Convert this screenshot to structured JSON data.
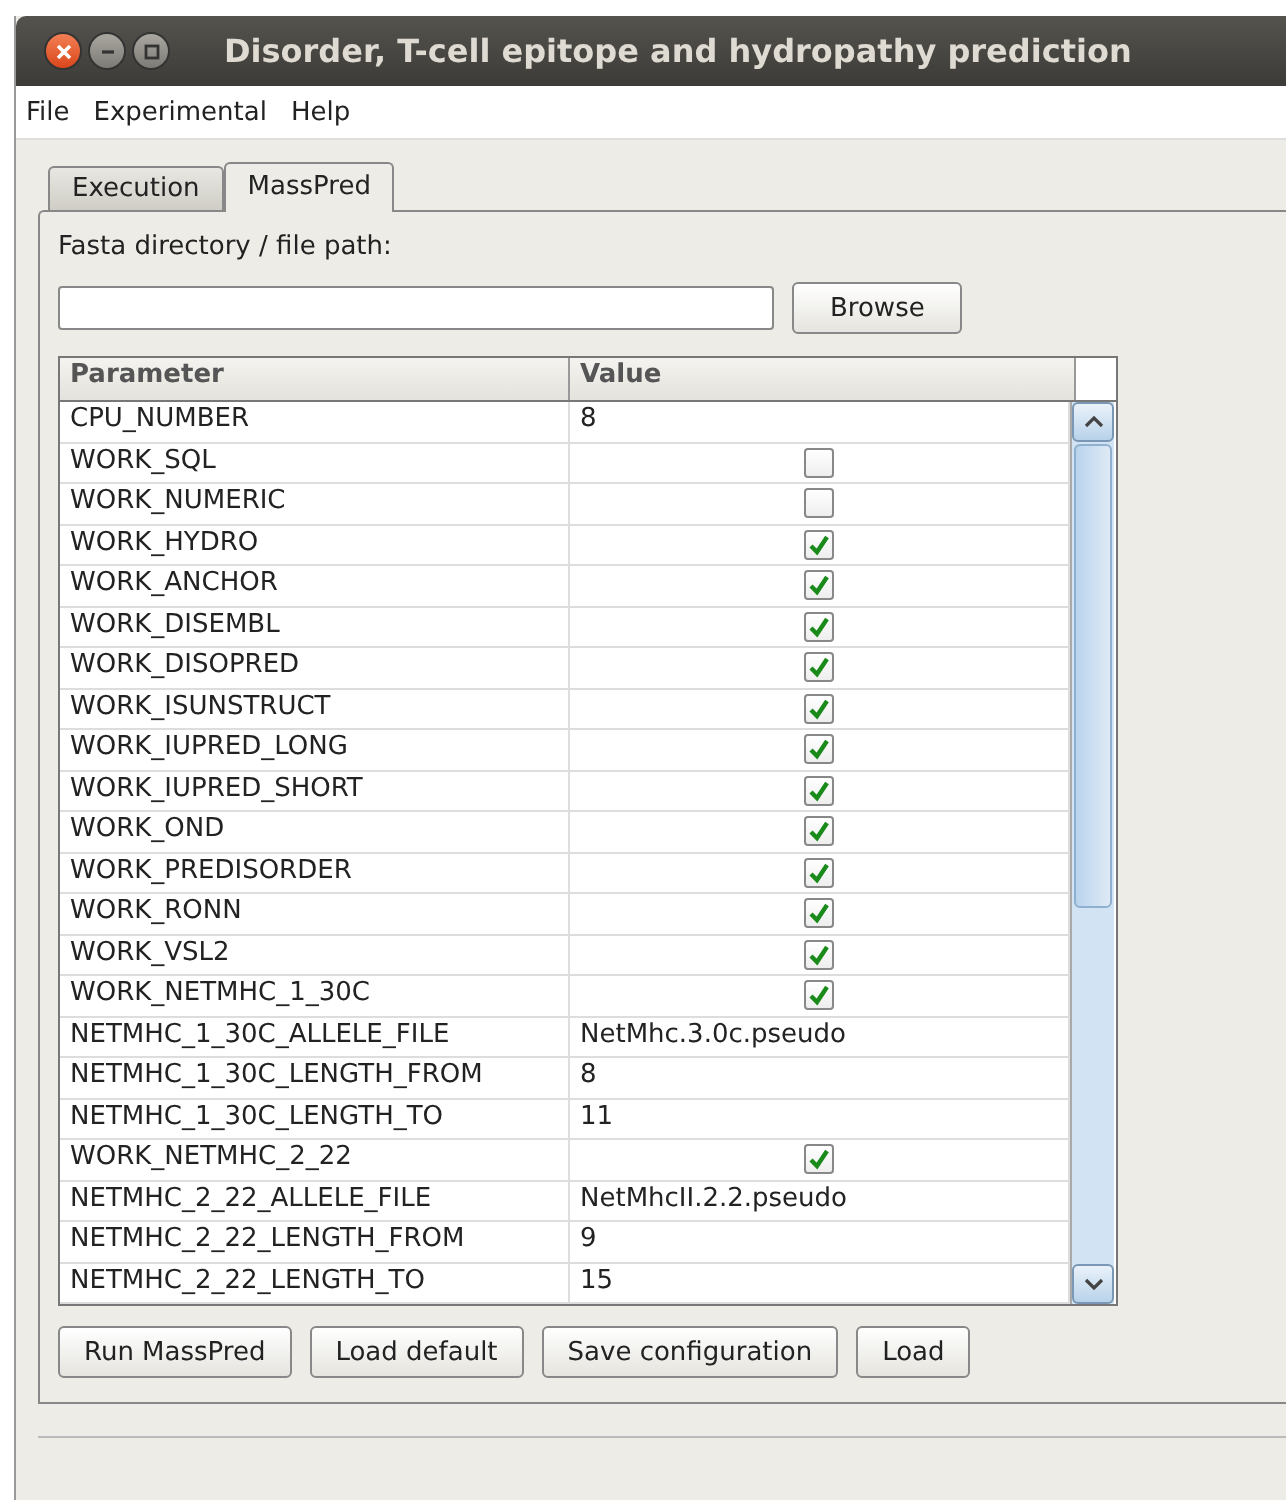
{
  "window": {
    "title": "Disorder, T-cell epitope and hydropathy prediction"
  },
  "menu": [
    "File",
    "Experimental",
    "Help"
  ],
  "tabs": [
    {
      "label": "Execution",
      "selected": false
    },
    {
      "label": "MassPred",
      "selected": true
    }
  ],
  "path_field": {
    "label": "Fasta directory / file path:",
    "browse": "Browse"
  },
  "table": {
    "columns": [
      "Parameter",
      "Value"
    ],
    "rows": [
      {
        "name": "CPU_NUMBER",
        "kind": "text",
        "value": "8"
      },
      {
        "name": "WORK_SQL",
        "kind": "checkbox",
        "checked": false
      },
      {
        "name": "WORK_NUMERIC",
        "kind": "checkbox",
        "checked": false
      },
      {
        "name": "WORK_HYDRO",
        "kind": "checkbox",
        "checked": true
      },
      {
        "name": "WORK_ANCHOR",
        "kind": "checkbox",
        "checked": true
      },
      {
        "name": "WORK_DISEMBL",
        "kind": "checkbox",
        "checked": true
      },
      {
        "name": "WORK_DISOPRED",
        "kind": "checkbox",
        "checked": true
      },
      {
        "name": "WORK_ISUNSTRUCT",
        "kind": "checkbox",
        "checked": true
      },
      {
        "name": "WORK_IUPRED_LONG",
        "kind": "checkbox",
        "checked": true
      },
      {
        "name": "WORK_IUPRED_SHORT",
        "kind": "checkbox",
        "checked": true
      },
      {
        "name": "WORK_OND",
        "kind": "checkbox",
        "checked": true
      },
      {
        "name": "WORK_PREDISORDER",
        "kind": "checkbox",
        "checked": true
      },
      {
        "name": "WORK_RONN",
        "kind": "checkbox",
        "checked": true
      },
      {
        "name": "WORK_VSL2",
        "kind": "checkbox",
        "checked": true
      },
      {
        "name": "WORK_NETMHC_1_30C",
        "kind": "checkbox",
        "checked": true
      },
      {
        "name": "NETMHC_1_30C_ALLELE_FILE",
        "kind": "text",
        "value": "NetMhc.3.0c.pseudo"
      },
      {
        "name": "NETMHC_1_30C_LENGTH_FROM",
        "kind": "text",
        "value": "8"
      },
      {
        "name": "NETMHC_1_30C_LENGTH_TO",
        "kind": "text",
        "value": "11"
      },
      {
        "name": "WORK_NETMHC_2_22",
        "kind": "checkbox",
        "checked": true
      },
      {
        "name": "NETMHC_2_22_ALLELE_FILE",
        "kind": "text",
        "value": "NetMhcII.2.2.pseudo"
      },
      {
        "name": "NETMHC_2_22_LENGTH_FROM",
        "kind": "text",
        "value": "9"
      },
      {
        "name": "NETMHC_2_22_LENGTH_TO",
        "kind": "text",
        "value": "15"
      }
    ]
  },
  "buttons": [
    "Run MassPred",
    "Load default",
    "Save configuration",
    "Load"
  ]
}
